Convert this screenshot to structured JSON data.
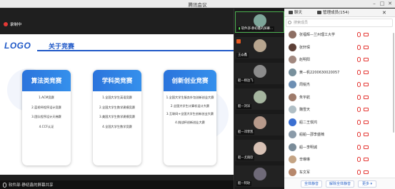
{
  "window": {
    "title": "腾讯会议",
    "controls": [
      "–",
      "□",
      "✕"
    ]
  },
  "recording": {
    "label": "录制中"
  },
  "slide": {
    "logo": "LOGO",
    "title": "关于竞赛",
    "cards": [
      {
        "heading": "算法类竞赛",
        "items": [
          "1.ACM竞赛",
          "2.蓝桥杯程序设计竞赛",
          "3.团队程序设计天梯赛",
          "4.CCF认证"
        ]
      },
      {
        "heading": "学科类竞赛",
        "items": [
          "1.全国大学生英语竞赛",
          "2.全国大学生数学建模竞赛",
          "3.美国大学生数学建模竞赛",
          "4.全国大学生数学竞赛"
        ]
      },
      {
        "heading": "创新创业竞赛",
        "items": [
          "1.全国大学生服务外包创新创业大赛",
          "2.全国大学生计算机设计大赛",
          "3.互联网+全国大学生创新创业大赛",
          "4.挑战杯创新创业大赛"
        ]
      }
    ]
  },
  "share_bar": {
    "label": "软件部-静初鑫的屏幕共享"
  },
  "videos": [
    {
      "name": "软件部-静初鑫的屏幕..."
    },
    {
      "name": "王焱鑫"
    },
    {
      "name": "船—杨泊飞"
    },
    {
      "name": "船—刘洋"
    },
    {
      "name": "船—邓李凯"
    },
    {
      "name": "船—尤雨欣"
    },
    {
      "name": "船—阿玫"
    }
  ],
  "panel": {
    "tabs": {
      "chat": "聊天",
      "members": "管理成员(154)"
    },
    "search_placeholder": "搜索成员",
    "members": [
      {
        "name": "张福辉—兰州理工大学",
        "color": "#8d6e63"
      },
      {
        "name": "张轩琛",
        "color": "#5d4037"
      },
      {
        "name": "赵明阳",
        "color": "#a1887f"
      },
      {
        "name": "黄—帆2200630020057",
        "color": "#78909c"
      },
      {
        "name": "周锐杰",
        "color": "#6d8fb3"
      },
      {
        "name": "朱宇航",
        "color": "#9e7b6b"
      },
      {
        "name": "魏雪天",
        "color": "#b0bec5"
      },
      {
        "name": "船二王琪鸿",
        "color": "#3b6fd1"
      },
      {
        "name": "船舶—邵李盛楠",
        "color": "#8a9aa8"
      },
      {
        "name": "船—李明诚",
        "color": "#7a8c99"
      },
      {
        "name": "辛琳琳",
        "color": "#c4a484"
      },
      {
        "name": "车文军",
        "color": "#b7876b"
      }
    ],
    "footer": {
      "mute_all": "全体静音",
      "unmute_all": "解除全体静音",
      "more": "更多 ▾"
    }
  },
  "colors": {
    "accent": "#1f58c7",
    "card_head": "#2c7de0",
    "muted": "#e53935"
  }
}
